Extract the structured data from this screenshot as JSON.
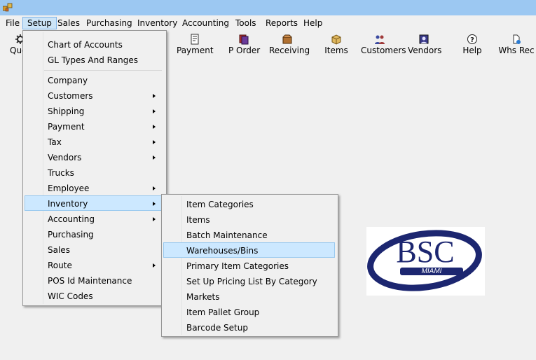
{
  "menubar": [
    "File",
    "Setup",
    "Sales",
    "Purchasing",
    "Inventory",
    "Accounting",
    "Tools",
    "Reports",
    "Help"
  ],
  "toolbar": {
    "quote": "Quo",
    "payment": "Payment",
    "porder": "P Order",
    "receiving": "Receiving",
    "items": "Items",
    "customers": "Customers",
    "vendors": "Vendors",
    "help": "Help",
    "whsrec": "Whs Rec"
  },
  "setup_menu": {
    "group1": [
      "Chart of Accounts",
      "GL Types And Ranges"
    ],
    "group2": [
      "Company",
      "Customers",
      "Shipping",
      "Payment",
      "Tax",
      "Vendors",
      "Trucks",
      "Employee",
      "Inventory",
      "Accounting",
      "Purchasing",
      "Sales",
      "Route",
      "POS Id Maintenance",
      "WIC Codes"
    ],
    "highlighted": "Inventory"
  },
  "inventory_submenu": {
    "items": [
      "Item Categories",
      "Items",
      "Batch Maintenance",
      "Warehouses/Bins",
      "Primary Item Categories",
      "Set Up Pricing List By Category",
      "Markets",
      "Item Pallet Group",
      "Barcode Setup"
    ],
    "highlighted": "Warehouses/Bins"
  },
  "logo": {
    "main": "BSC",
    "sub": "MIAMI",
    "color": "#1c2670"
  }
}
